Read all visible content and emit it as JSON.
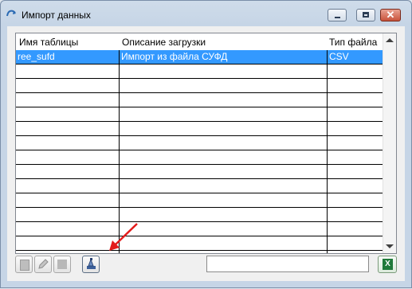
{
  "window": {
    "title": "Импорт данных"
  },
  "grid": {
    "columns": [
      "Имя таблицы",
      "Описание загрузки",
      "Тип файла"
    ],
    "rows": [
      {
        "name": "ree_sufd",
        "description": "Импорт из файла СУФД",
        "type": "CSV",
        "selected": true
      }
    ],
    "empty_rows": 13
  },
  "toolbar": {
    "buttons": [
      "document-icon",
      "pencil-icon",
      "export-icon",
      "import-settings-icon"
    ],
    "filter_value": "",
    "export_excel": "excel-icon"
  },
  "colors": {
    "selection": "#3399ff",
    "annotation_arrow": "#e31b1b"
  }
}
